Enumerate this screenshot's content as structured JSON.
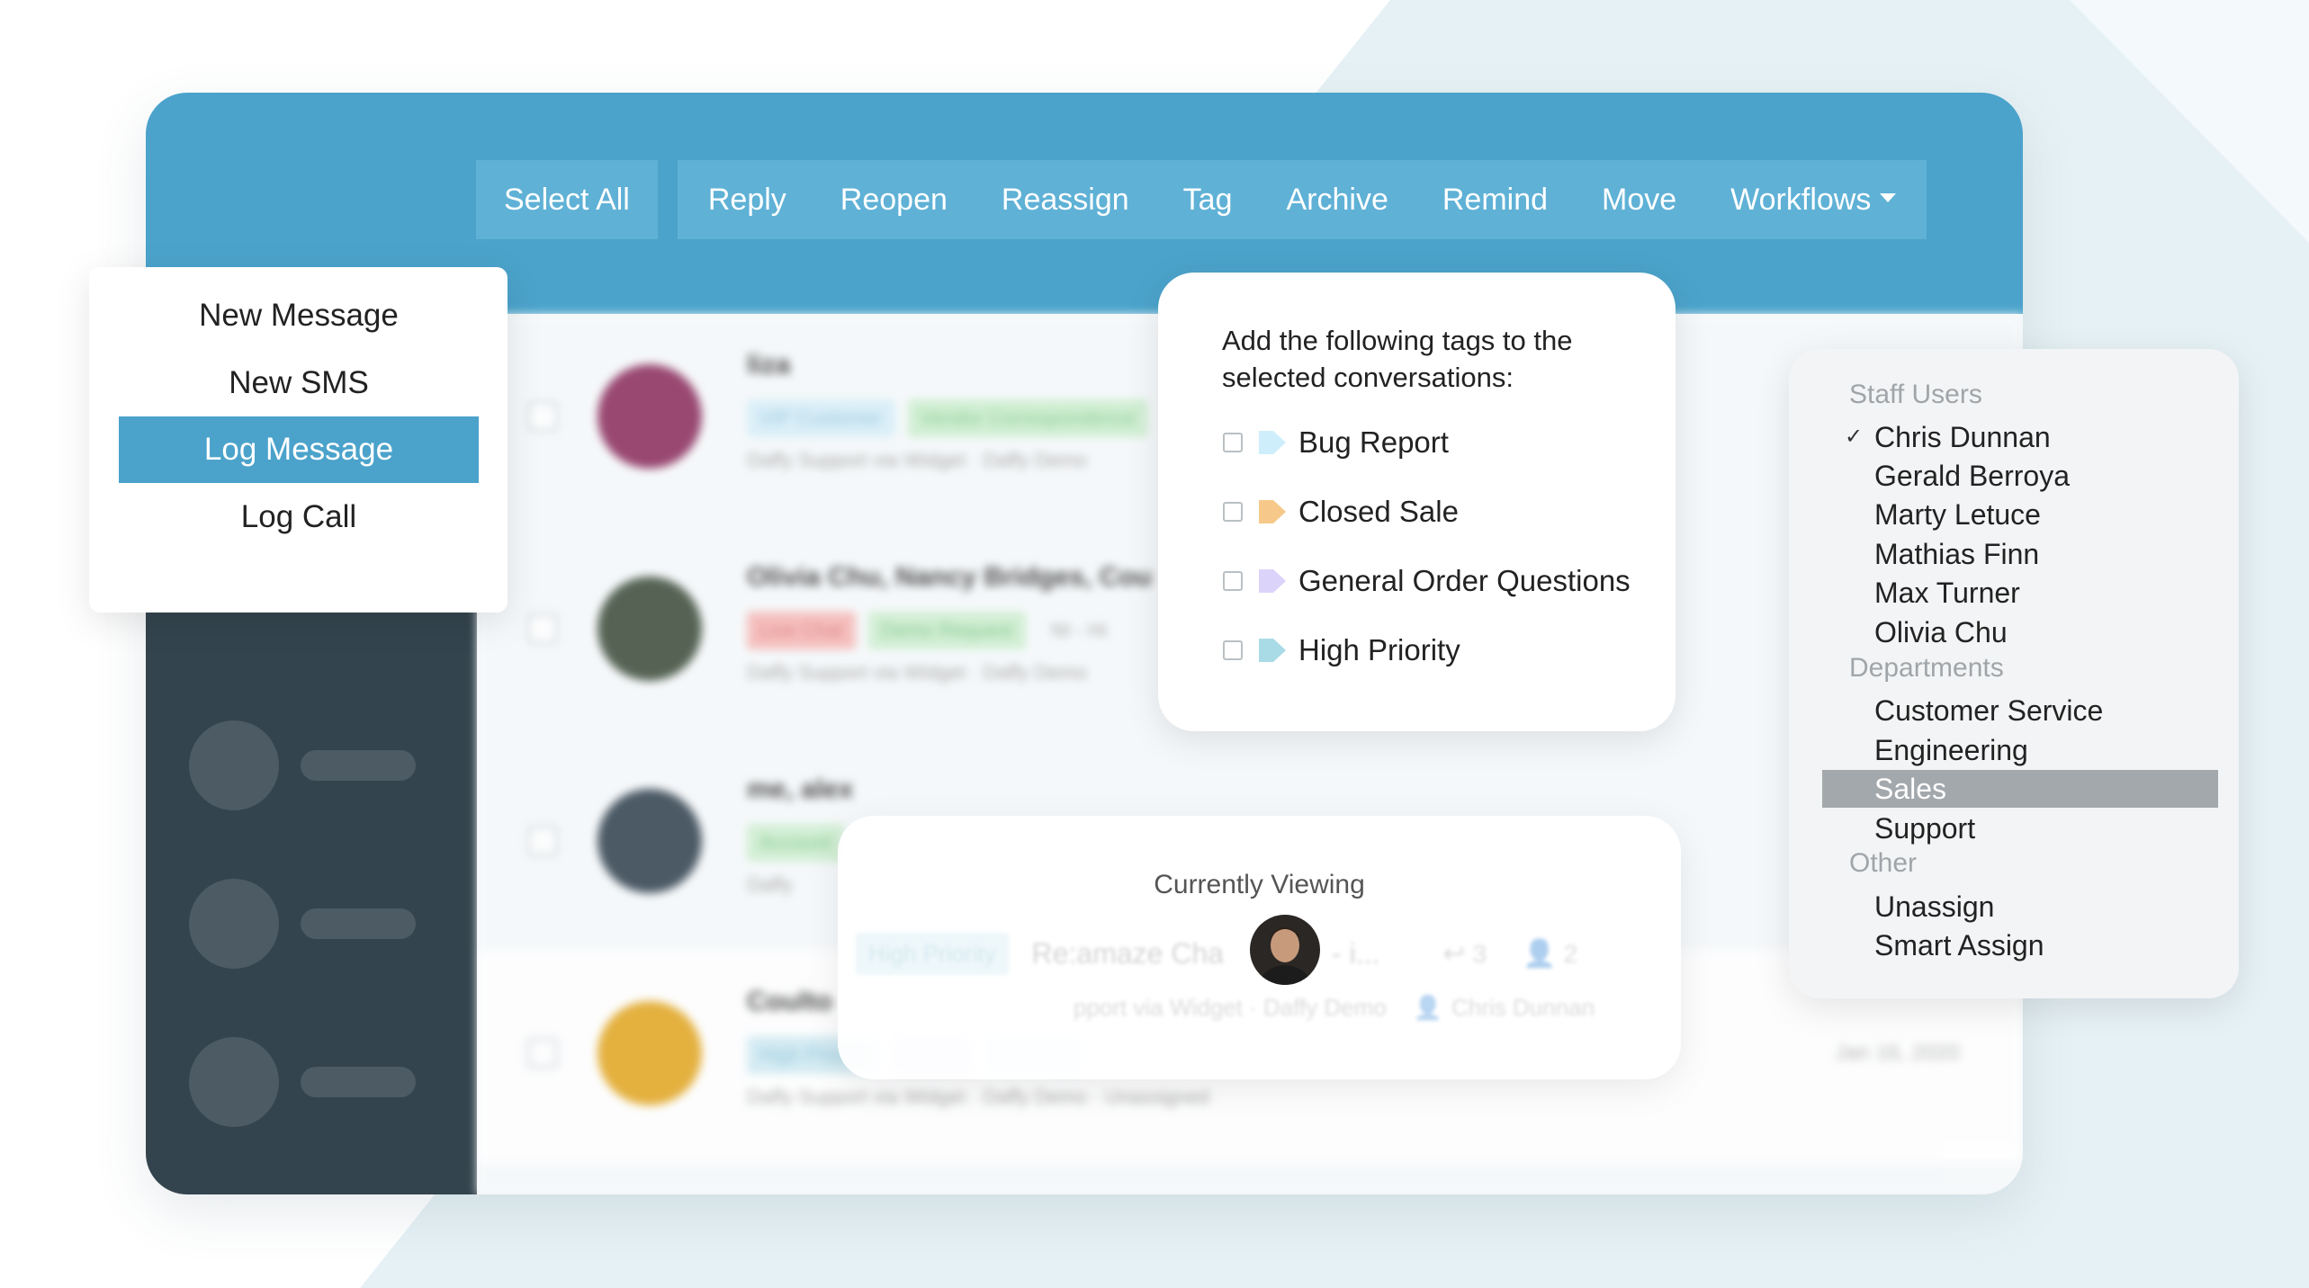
{
  "colors": {
    "brand": "#4ba3cb",
    "toolbar_group": "#5fb1d6",
    "sidebar": "#34444e",
    "menu_active": "#4ba3cb",
    "dropdown_selected": "#a3a8ac"
  },
  "toolbar": {
    "select_all": "Select All",
    "actions": [
      "Reply",
      "Reopen",
      "Reassign",
      "Tag",
      "Archive",
      "Remind",
      "Move",
      "Workflows"
    ]
  },
  "new_menu": {
    "items": [
      "New Message",
      "New SMS",
      "Log Message",
      "Log Call"
    ],
    "active_item": "Log Message"
  },
  "tag_popup": {
    "title": "Add the following tags to the selected conversations:",
    "tags": [
      {
        "label": "Bug Report",
        "color": "#cfeefb"
      },
      {
        "label": "Closed Sale",
        "color": "#f6c98a"
      },
      {
        "label": "General Order Questions",
        "color": "#dcd3fb"
      },
      {
        "label": "High Priority",
        "color": "#a9dbe7"
      }
    ]
  },
  "conversations": [
    {
      "name": "liza",
      "tags": [
        {
          "text": "VIP Customer",
          "bg": "#d6eef8",
          "fg": "#8fc1d8"
        },
        {
          "text": "Vendor Correspondence",
          "bg": "#cbeecd",
          "fg": "#7cc584"
        }
      ],
      "meta": "Daffy Support via Widget · Daffy Demo",
      "date": "",
      "avatar": "#8a2a5a"
    },
    {
      "name": "Olivia Chu, Nancy Bridges, Cou",
      "tags": [
        {
          "text": "Live Chat",
          "bg": "#f6b7b5",
          "fg": "#d96f6b"
        },
        {
          "text": "Demo Request",
          "bg": "#cdeecf",
          "fg": "#72c07c"
        },
        {
          "text": "NI - Hi",
          "bg": "transparent",
          "fg": "#999"
        }
      ],
      "meta": "Daffy Support via Widget · Daffy Demo",
      "date": "",
      "avatar": "#3b4a38"
    },
    {
      "name": "me, alex",
      "tags": [
        {
          "text": "Account",
          "bg": "#cdeecf",
          "fg": "#72c07c"
        }
      ],
      "meta": "Daffy",
      "date": "",
      "avatar": "#2f3f4c"
    },
    {
      "name": "Coulto",
      "tags": [
        {
          "text": "High Priority",
          "bg": "#cfe9f2",
          "fg": "#86c2d6"
        },
        {
          "text": "",
          "bg": "#d9c6f5",
          "fg": "#a78bdb"
        },
        {
          "text": "",
          "bg": "#d6eef8",
          "fg": "#8fc1d8"
        }
      ],
      "meta": "Daffy Support via Widget · Daffy Demo · Unassigned",
      "date": "Jan 16, 2020",
      "avatar": "#e2a51f"
    }
  ],
  "currently_viewing": {
    "title": "Currently Viewing",
    "tag": "High Priority",
    "subject": "Re:amaze Cha",
    "suffix": "- i...",
    "reply_count": "3",
    "user_count": "2",
    "meta": "pport via Widget · Daffy Demo",
    "assignee": "Chris Dunnan"
  },
  "assign_dropdown": {
    "sections": [
      {
        "heading": "Staff Users",
        "items": [
          "Chris Dunnan",
          "Gerald Berroya",
          "Marty Letuce",
          "Mathias Finn",
          "Max Turner",
          "Olivia Chu"
        ]
      },
      {
        "heading": "Departments",
        "items": [
          "Customer Service",
          "Engineering",
          "Sales",
          "Support"
        ]
      },
      {
        "heading": "Other",
        "items": [
          "Unassign",
          "Smart Assign"
        ]
      }
    ],
    "checked": "Chris Dunnan",
    "selected": "Sales",
    "check_mark": "✓"
  }
}
